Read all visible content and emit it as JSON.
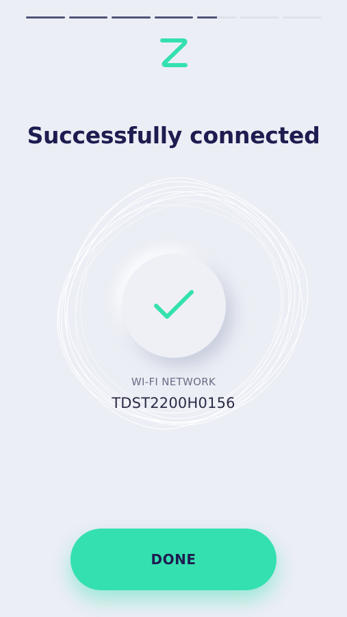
{
  "progress": {
    "total_steps": 7,
    "completed_steps": 4,
    "current_step_fraction": 0.5
  },
  "logo": {
    "icon": "z-logo-icon",
    "color": "#35e0af"
  },
  "title": "Successfully connected",
  "status": {
    "icon": "checkmark-icon",
    "color": "#35e0af"
  },
  "network": {
    "label": "WI-FI NETWORK",
    "name": "TDST2200H0156"
  },
  "done_button": {
    "label": "DONE",
    "color": "#35e0af"
  }
}
